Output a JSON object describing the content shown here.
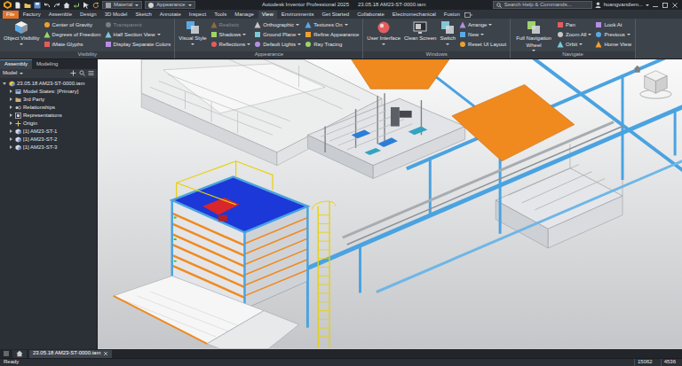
{
  "title_bar": {
    "app_title": "Autodesk Inventor Professional 2025",
    "document_title": "23.05.18 AM23-ST-0000.iam",
    "material": "Material",
    "appearance": "Appearance",
    "user": "hoangvandiem..."
  },
  "search": {
    "placeholder": "Search Help & Commands..."
  },
  "ribbon_tabs": [
    {
      "label": "File",
      "selected": false,
      "kind": "file"
    },
    {
      "label": "Factory",
      "selected": false,
      "kind": "tab"
    },
    {
      "label": "Assemble",
      "selected": false,
      "kind": "tab"
    },
    {
      "label": "Design",
      "selected": false,
      "kind": "tab"
    },
    {
      "label": "3D Model",
      "selected": false,
      "kind": "tab"
    },
    {
      "label": "Sketch",
      "selected": false,
      "kind": "tab"
    },
    {
      "label": "Annotate",
      "selected": false,
      "kind": "tab"
    },
    {
      "label": "Inspect",
      "selected": false,
      "kind": "tab"
    },
    {
      "label": "Tools",
      "selected": false,
      "kind": "tab"
    },
    {
      "label": "Manage",
      "selected": false,
      "kind": "tab"
    },
    {
      "label": "View",
      "selected": true,
      "kind": "tab"
    },
    {
      "label": "Environments",
      "selected": false,
      "kind": "tab"
    },
    {
      "label": "Get Started",
      "selected": false,
      "kind": "tab"
    },
    {
      "label": "Collaborate",
      "selected": false,
      "kind": "tab"
    },
    {
      "label": "Electromechanical",
      "selected": false,
      "kind": "tab"
    },
    {
      "label": "Fusion",
      "selected": false,
      "kind": "tab"
    }
  ],
  "ribbon_groups": [
    {
      "title": "Visibility",
      "columns": [
        [
          {
            "label": "Object Visibility",
            "kind": "large",
            "dropdown": true,
            "disabled": false
          }
        ],
        [
          {
            "label": "Center of Gravity",
            "kind": "small",
            "dropdown": false,
            "disabled": false
          },
          {
            "label": "Degrees of Freedom",
            "kind": "small",
            "dropdown": false,
            "disabled": false
          },
          {
            "label": "iMate Glyphs",
            "kind": "small",
            "dropdown": false,
            "disabled": false
          }
        ],
        [
          {
            "label": "Transparent",
            "kind": "small",
            "dropdown": false,
            "disabled": true
          },
          {
            "label": "Half Section View",
            "kind": "small",
            "dropdown": true,
            "disabled": false
          },
          {
            "label": "Display Separate Colors",
            "kind": "small",
            "dropdown": false,
            "disabled": false
          }
        ]
      ]
    },
    {
      "title": "Appearance",
      "columns": [
        [
          {
            "label": "Visual Style",
            "kind": "large",
            "dropdown": true,
            "disabled": false
          }
        ],
        [
          {
            "label": "Realistic",
            "kind": "small",
            "dropdown": false,
            "disabled": true
          },
          {
            "label": "Shadows",
            "kind": "small",
            "dropdown": true,
            "disabled": false
          },
          {
            "label": "Reflections",
            "kind": "small",
            "dropdown": true,
            "disabled": false
          }
        ],
        [
          {
            "label": "Orthographic",
            "kind": "small",
            "dropdown": true,
            "disabled": false
          },
          {
            "label": "Ground Plane",
            "kind": "small",
            "dropdown": true,
            "disabled": false
          },
          {
            "label": "Default Lights",
            "kind": "small",
            "dropdown": true,
            "disabled": false
          }
        ],
        [
          {
            "label": "Textures On",
            "kind": "small",
            "dropdown": true,
            "disabled": false
          },
          {
            "label": "Refine Appearance",
            "kind": "small",
            "dropdown": false,
            "disabled": false
          },
          {
            "label": "Ray Tracing",
            "kind": "small",
            "dropdown": false,
            "disabled": false
          }
        ]
      ]
    },
    {
      "title": "Windows",
      "columns": [
        [
          {
            "label": "User Interface",
            "kind": "large",
            "dropdown": true,
            "disabled": false
          }
        ],
        [
          {
            "label": "Clean Screen",
            "kind": "large",
            "dropdown": false,
            "disabled": false
          }
        ],
        [
          {
            "label": "Switch",
            "kind": "large",
            "dropdown": true,
            "disabled": false
          }
        ],
        [
          {
            "label": "Arrange",
            "kind": "small",
            "dropdown": true,
            "disabled": false
          },
          {
            "label": "New",
            "kind": "small",
            "dropdown": true,
            "disabled": false
          },
          {
            "label": "Reset UI Layout",
            "kind": "small",
            "dropdown": false,
            "disabled": false
          }
        ]
      ]
    },
    {
      "title": "Navigate",
      "columns": [
        [
          {
            "label": "Full Navigation Wheel",
            "kind": "large",
            "dropdown": true,
            "disabled": false
          }
        ],
        [
          {
            "label": "Pan",
            "kind": "small",
            "dropdown": false,
            "disabled": false
          },
          {
            "label": "Zoom All",
            "kind": "small",
            "dropdown": true,
            "disabled": false
          },
          {
            "label": "Orbit",
            "kind": "small",
            "dropdown": true,
            "disabled": false
          }
        ],
        [
          {
            "label": "Look At",
            "kind": "small",
            "dropdown": false,
            "disabled": false
          },
          {
            "label": "Previous",
            "kind": "small",
            "dropdown": true,
            "disabled": false
          },
          {
            "label": "Home View",
            "kind": "small",
            "dropdown": false,
            "disabled": false
          }
        ]
      ]
    }
  ],
  "browser": {
    "tabs": [
      {
        "label": "Assembly",
        "selected": true
      },
      {
        "label": "Modeling",
        "selected": false
      }
    ],
    "header": "Model",
    "tree": [
      {
        "label": "23.05.18 AM23-ST-0000.iam",
        "expanded": true,
        "children": [
          {
            "label": "Model States: [Primary]",
            "expanded": false
          },
          {
            "label": "3rd Party",
            "expanded": false
          },
          {
            "label": "Relationships",
            "expanded": false
          },
          {
            "label": "Representations",
            "expanded": false
          },
          {
            "label": "Origin",
            "expanded": false
          },
          {
            "label": "[1] AM23-ST-1",
            "expanded": false
          },
          {
            "label": "[1] AM23-ST-2",
            "expanded": false
          },
          {
            "label": "[1] AM23-ST-3",
            "expanded": false
          }
        ]
      }
    ]
  },
  "document_tabs": [
    {
      "label": "23.05.18 AM23-ST-0000.iam",
      "selected": true
    }
  ],
  "status_bar": {
    "message": "Ready",
    "counts": [
      "15062",
      "4536"
    ]
  }
}
